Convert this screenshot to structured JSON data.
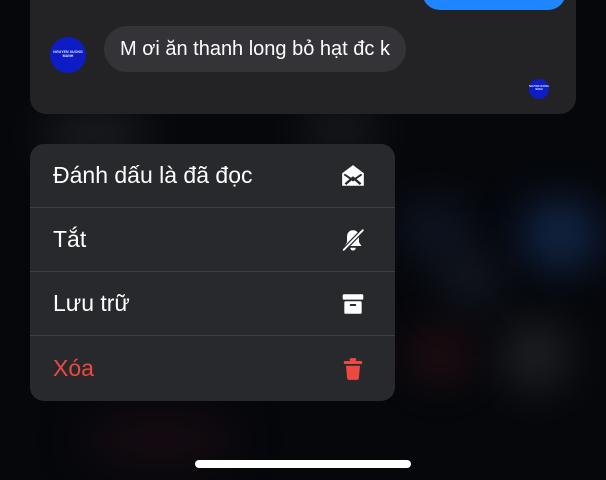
{
  "colors": {
    "background": "#05070b",
    "card": "#232326",
    "bubble_received": "#333338",
    "bubble_sent": "#1f86ff",
    "menu": "#28292d",
    "danger": "#eb4a40",
    "avatar": "#0d1cc4"
  },
  "conversation": {
    "avatar_text": "NGUYEN XUONG MANH",
    "message_text": "M ơi ăn thanh long bỏ hạt đc k"
  },
  "context_menu": {
    "items": [
      {
        "label": "Đánh dấu là đã đọc",
        "icon": "envelope-open-icon"
      },
      {
        "label": "Tắt",
        "icon": "bell-slash-icon"
      },
      {
        "label": "Lưu trữ",
        "icon": "archive-box-icon"
      },
      {
        "label": "Xóa",
        "icon": "trash-icon",
        "destructive": true
      }
    ]
  }
}
